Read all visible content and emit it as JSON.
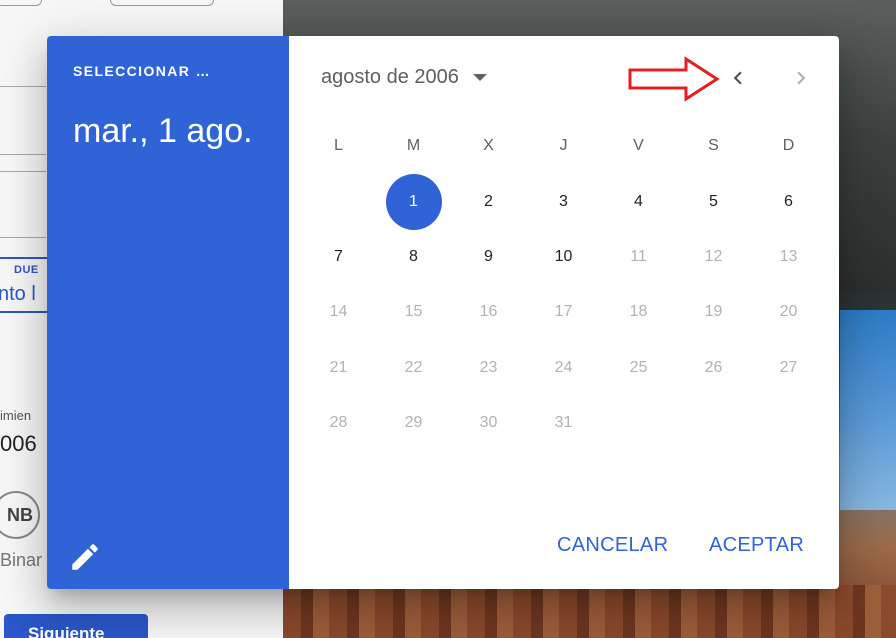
{
  "background": {
    "due_label": "DUE",
    "due_value": "nto l",
    "field_label": "imien",
    "year_value": "006",
    "avatar_initials": "NB",
    "avatar_name": "Binar",
    "next_button": "Siguiente"
  },
  "dialog": {
    "overline": "SELECCIONAR …",
    "title": "mar., 1 ago.",
    "edit_icon": "pencil-icon",
    "month_label": "agosto de 2006",
    "weekdays": [
      "L",
      "M",
      "X",
      "J",
      "V",
      "S",
      "D"
    ],
    "leading_blank_days": 1,
    "days": [
      {
        "n": "1",
        "enabled": true,
        "selected": true
      },
      {
        "n": "2",
        "enabled": true
      },
      {
        "n": "3",
        "enabled": true
      },
      {
        "n": "4",
        "enabled": true
      },
      {
        "n": "5",
        "enabled": true
      },
      {
        "n": "6",
        "enabled": true
      },
      {
        "n": "7",
        "enabled": true
      },
      {
        "n": "8",
        "enabled": true
      },
      {
        "n": "9",
        "enabled": true
      },
      {
        "n": "10",
        "enabled": true
      },
      {
        "n": "11",
        "enabled": false
      },
      {
        "n": "12",
        "enabled": false
      },
      {
        "n": "13",
        "enabled": false
      },
      {
        "n": "14",
        "enabled": false
      },
      {
        "n": "15",
        "enabled": false
      },
      {
        "n": "16",
        "enabled": false
      },
      {
        "n": "17",
        "enabled": false
      },
      {
        "n": "18",
        "enabled": false
      },
      {
        "n": "19",
        "enabled": false
      },
      {
        "n": "20",
        "enabled": false
      },
      {
        "n": "21",
        "enabled": false
      },
      {
        "n": "22",
        "enabled": false
      },
      {
        "n": "23",
        "enabled": false
      },
      {
        "n": "24",
        "enabled": false
      },
      {
        "n": "25",
        "enabled": false
      },
      {
        "n": "26",
        "enabled": false
      },
      {
        "n": "27",
        "enabled": false
      },
      {
        "n": "28",
        "enabled": false
      },
      {
        "n": "29",
        "enabled": false
      },
      {
        "n": "30",
        "enabled": false
      },
      {
        "n": "31",
        "enabled": false
      }
    ],
    "cancel_label": "CANCELAR",
    "ok_label": "ACEPTAR"
  },
  "colors": {
    "accent": "#3064d6",
    "annotation_arrow": "#e02020",
    "disabled_text": "#b2b2b2"
  },
  "icons": {
    "prev": "chevron-left-icon",
    "next": "chevron-right-icon",
    "dropdown": "arrow-drop-down-icon",
    "annotation": "red-arrow-annotation"
  }
}
